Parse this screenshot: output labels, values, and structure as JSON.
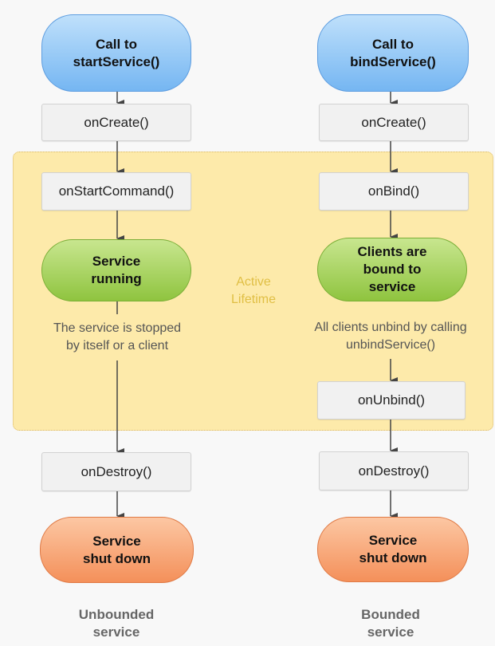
{
  "start_column": {
    "start": "Call to\nstartService()",
    "on_create": "onCreate()",
    "on_start_command": "onStartCommand()",
    "running": "Service\nrunning",
    "note": "The service is stopped\nby itself or a client",
    "on_destroy": "onDestroy()",
    "shut_down": "Service\nshut down",
    "label": "Unbounded\nservice"
  },
  "bind_column": {
    "start": "Call to\nbindService()",
    "on_create": "onCreate()",
    "on_bind": "onBind()",
    "bound": "Clients are\nbound to\nservice",
    "note": "All clients unbind by calling\nunbindService()",
    "on_unbind": "onUnbind()",
    "on_destroy": "onDestroy()",
    "shut_down": "Service\nshut down",
    "label": "Bounded\nservice"
  },
  "active_lifetime": "Active\nLifetime",
  "colors": {
    "start": "#75b6f2",
    "running": "#8fc43f",
    "shutdown": "#f4905a",
    "active_zone": "#fdeaaa"
  }
}
